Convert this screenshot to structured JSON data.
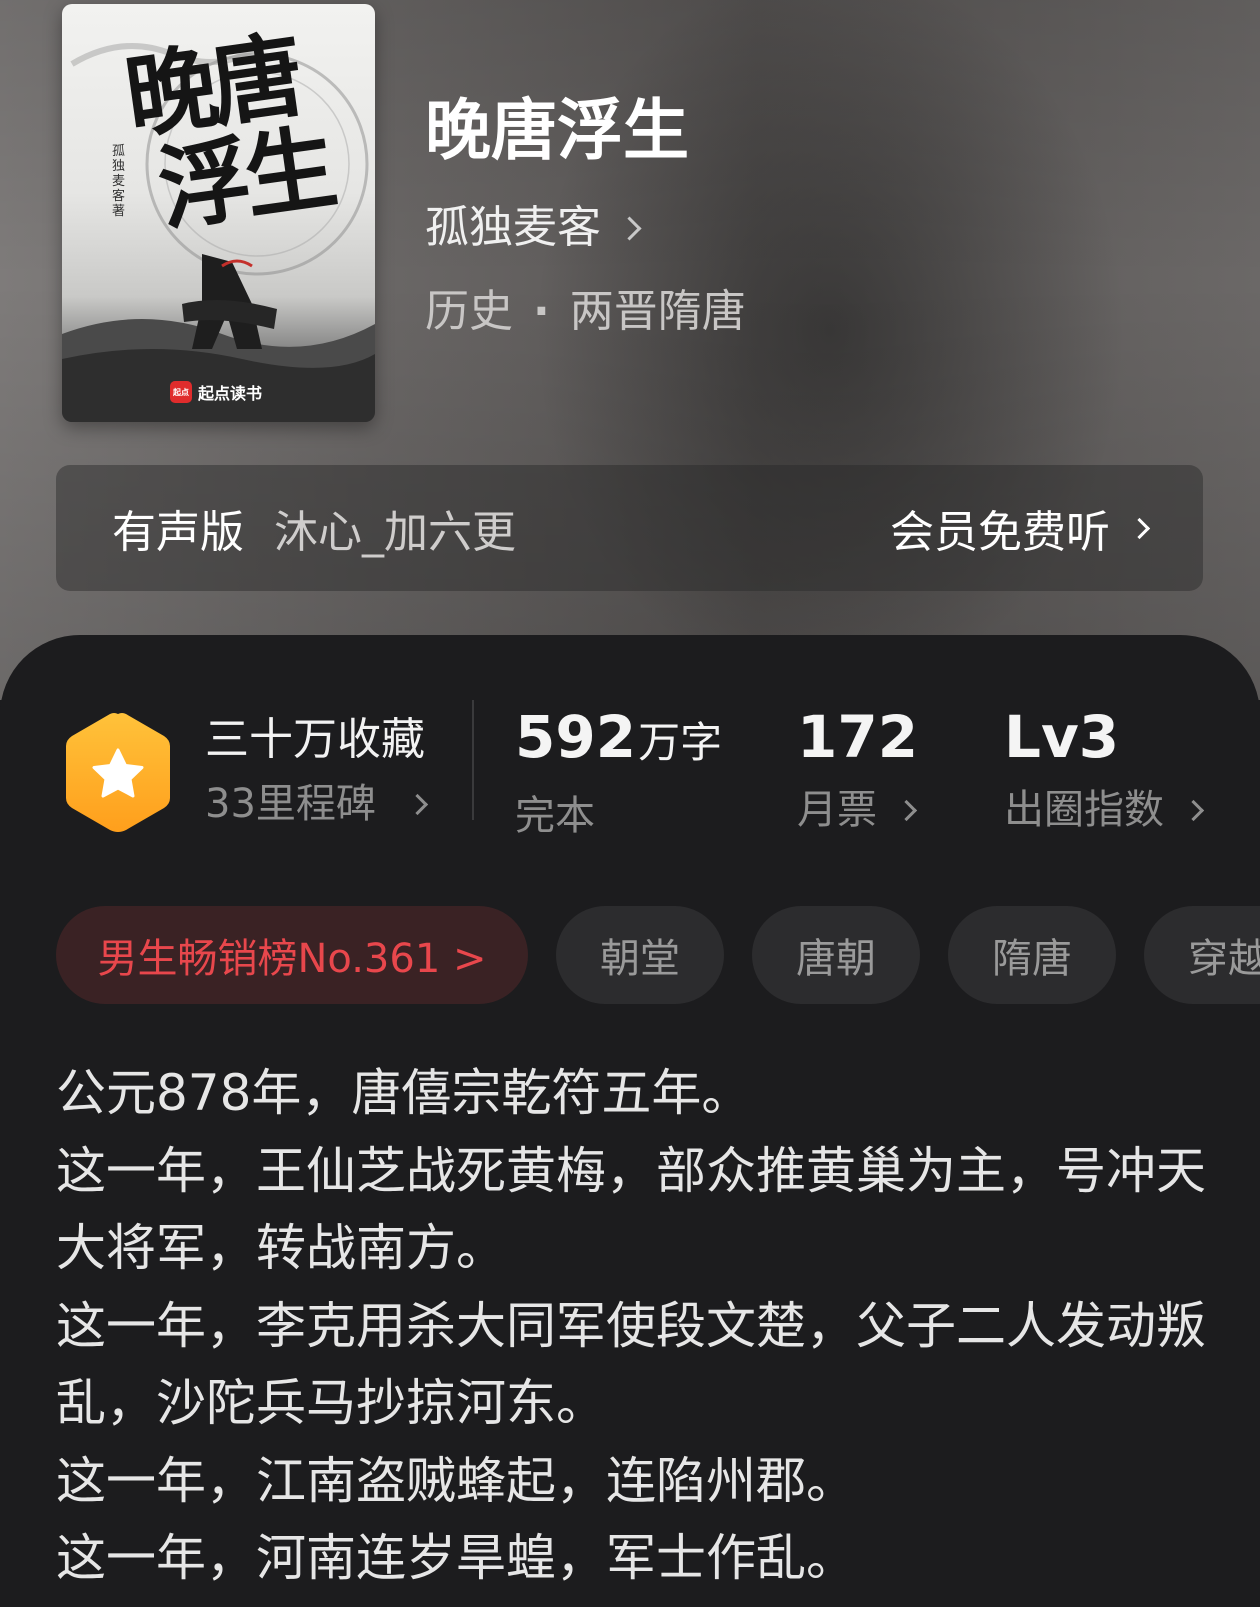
{
  "book": {
    "title": "晚唐浮生",
    "author": "孤独麦客",
    "category": "历史",
    "subcategory": "两晋隋唐",
    "genre_separator": "·"
  },
  "cover": {
    "title_line1": "晚唐",
    "title_line2": "浮生",
    "author_text": "孤独麦客著",
    "publisher": "起点读书",
    "publisher_logo_text": "起点"
  },
  "audio": {
    "label": "有声版",
    "narrator": "沐心_加六更",
    "cta": "会员免费听"
  },
  "stats": {
    "favorites": "三十万收藏",
    "milestones": "33里程碑",
    "word_count_number": "592",
    "word_count_unit": "万字",
    "status": "完本",
    "monthly_tickets": "172",
    "monthly_tickets_label": "月票",
    "level": "Lv3",
    "level_label": "出圈指数"
  },
  "tags": {
    "rank": "男生畅销榜No.361 >",
    "items": [
      "朝堂",
      "唐朝",
      "隋唐",
      "穿越"
    ]
  },
  "synopsis": [
    "公元878年，唐僖宗乾符五年。",
    "这一年，王仙芝战死黄梅，部众推黄巢为主，号冲天大将军，转战南方。",
    "这一年，李克用杀大同军使段文楚，父子二人发动叛乱，沙陀兵马抄掠河东。",
    "这一年，江南盗贼蜂起，连陷州郡。",
    "这一年，河南连岁旱蝗，军士作乱。"
  ],
  "colors": {
    "rank_text": "#e8474c",
    "rank_bg": "#3a2224",
    "badge_orange": "#ffb22e",
    "panel_bg": "#1c1c1e"
  }
}
